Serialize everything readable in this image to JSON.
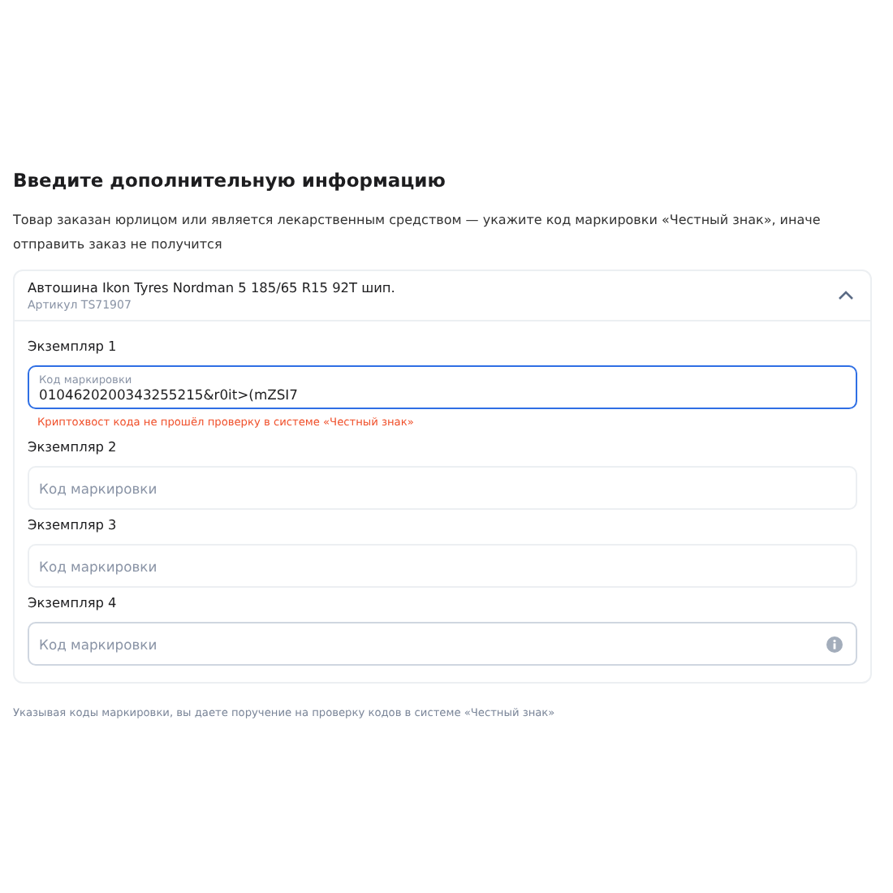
{
  "title": "Введите дополнительную информацию",
  "description": "Товар заказан юрлицом или является лекарственным средством — укажите код маркировки «Честный знак», иначе отправить заказ не получится",
  "product": {
    "name": "Автошина Ikon Tyres Nordman 5 185/65 R15 92T шип.",
    "sku": "Артикул TS71907",
    "expanded": true,
    "items": [
      {
        "label": "Экземпляр 1",
        "placeholder": "Код маркировки",
        "value": "0104620200343255215&r0it>(mZSI7",
        "focused": true,
        "hovered": false,
        "error": "Криптохвост кода не прошёл проверку в системе «Честный знак»"
      },
      {
        "label": "Экземпляр 2",
        "placeholder": "Код маркировки",
        "focused": false,
        "hovered": false
      },
      {
        "label": "Экземпляр 3",
        "placeholder": "Код маркировки",
        "focused": false,
        "hovered": false
      },
      {
        "label": "Экземпляр 4",
        "placeholder": "Код маркировки",
        "focused": false,
        "hovered": true
      }
    ]
  },
  "footnote": "Указывая коды маркировки, вы даете поручение на проверку кодов в системе «Честный знак»"
}
